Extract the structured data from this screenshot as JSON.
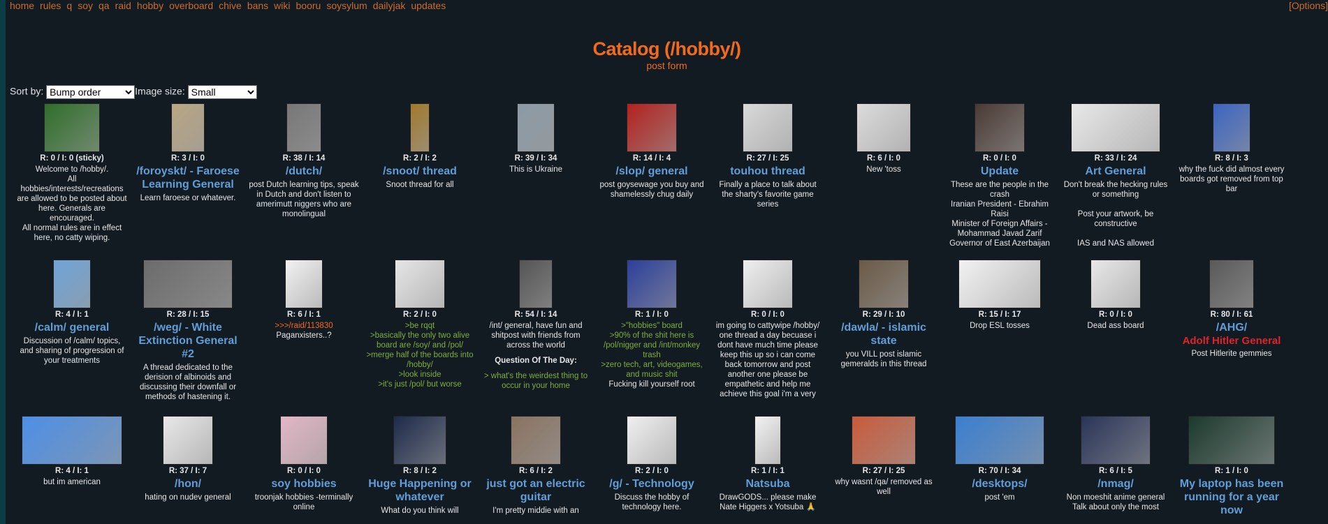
{
  "nav": {
    "links": [
      "home",
      "rules",
      "q",
      "soy",
      "qa",
      "raid",
      "hobby",
      "overboard",
      "chive",
      "bans",
      "wiki",
      "booru",
      "soysylum",
      "dailyjak",
      "updates"
    ],
    "options": "[Options]"
  },
  "header": {
    "title": "Catalog (/hobby/)",
    "post_form": "post form"
  },
  "controls": {
    "sort_label": "Sort by:",
    "sort_value": "Bump order",
    "image_label": "Image size:",
    "image_value": "Small"
  },
  "threads": [
    {
      "stats": "R: 0 / I: 0 (sticky)",
      "subject": "",
      "body": "Welcome to /hobby/.\nAll hobbies/interests/recreations are allowed to be posted about here. Generals are encouraged.\nAll normal rules are in effect here, no catty wiping.",
      "thumb": "#2f6e2a"
    },
    {
      "stats": "R: 3 / I: 0",
      "subject": "/foroyskt/ - Faroese Learning General",
      "body": "Learn faroese or whatever.",
      "thumb": "#b9a684"
    },
    {
      "stats": "R: 38 / I: 14",
      "subject": "/dutch/",
      "body": "post Dutch learning tips, speak in Dutch and don't listen to amerimutt niggers who are monolingual",
      "thumb": "#777777"
    },
    {
      "stats": "R: 2 / I: 2",
      "subject": "/snoot/ thread",
      "body": "Snoot thread for all",
      "thumb": "#a27a2c"
    },
    {
      "stats": "R: 39 / I: 34",
      "subject": "",
      "body": "This is Ukraine",
      "thumb": "#8c9aa6"
    },
    {
      "stats": "R: 14 / I: 4",
      "subject": "/slop/ general",
      "body": "post goysewage you buy and shamelessly chug daily",
      "thumb": "#b2221f"
    },
    {
      "stats": "R: 27 / I: 25",
      "subject": "touhou thread",
      "body": "Finally a place to talk about the sharty's favorite game series",
      "thumb": "#d9d9d9"
    },
    {
      "stats": "R: 6 / I: 0",
      "subject": "",
      "body": "New 'toss",
      "thumb": "#dcdcdc"
    },
    {
      "stats": "R: 0 / I: 0",
      "subject": "Update",
      "body": "These are the people in the crash\nIranian President - Ebrahim Raisi\nMinister of Foreign Affairs - Mohammad Javad Zarif\nGovernor of East Azerbaijan",
      "thumb": "#4a3a34"
    },
    {
      "stats": "R: 33 / I: 24",
      "subject": "Art General",
      "body": "Don't break the hecking rules or something\n\nPost your artwork, be constructive\n\nIAS and NAS allowed",
      "thumb": "#e8e8e8"
    },
    {
      "stats": "R: 8 / I: 3",
      "subject": "",
      "body": "why the fuck did almost every boards got removed from top bar",
      "thumb": "#3b64c2"
    },
    {
      "stats": "R: 4 / I: 1",
      "subject": "/calm/ general",
      "body": "Discussion of /calm/ topics, and sharing of progression of your treatments",
      "thumb": "#6fa4d9"
    },
    {
      "stats": "R: 28 / I: 15",
      "subject": "/weg/ - White Extinction General #2",
      "body": "A thread dedicated to the derision of albinoids and discussing their downfall or methods of hastening it.",
      "thumb": "#6c6c6c"
    },
    {
      "stats": "R: 6 / I: 1",
      "subject": "",
      "link": ">>>/raid/113830",
      "body": "Paganxisters..?",
      "thumb": "#f2f2f2"
    },
    {
      "stats": "R: 2 / I: 0",
      "subject": "",
      "greentext": ">be rqqt\n>basically the only two alive board are /soy/ and /pol/\n>merge half of the boards into /hobby/\n>look inside\n>it's just /pol/ but worse",
      "body": "",
      "thumb": "#e6e6e6"
    },
    {
      "stats": "R: 54 / I: 14",
      "subject": "",
      "body": "/int/ general, have fun and shitpost with friends from across the world",
      "qotd": "Question Of The Day:",
      "greentext": "> what's the weirdest thing to occur in your home",
      "thumb": "#555555"
    },
    {
      "stats": "R: 1 / I: 0",
      "subject": "",
      "greentext": ">\"hobbies\" board\n>90% of the shit here is /pol/nigger and /int/monkey trash\n>zero tech, art, videogames, and music shit",
      "body": "Fucking kill yourself root",
      "thumb": "#2c3f9b"
    },
    {
      "stats": "R: 0 / I: 0",
      "subject": "",
      "body": "im going to cattywipe /hobby/ one thread a day becuase i dont have much time please keep this up so i can come back tomorrow and post another one please be empathetic and help me achieve this goal i'm a very",
      "thumb": "#efefef"
    },
    {
      "stats": "R: 29 / I: 10",
      "subject": "/dawla/ - islamic state",
      "body": "you VILL post islamic gemeralds in this thread",
      "thumb": "#6b5a47"
    },
    {
      "stats": "R: 15 / I: 17",
      "subject": "",
      "body": "Drop ESL tosses",
      "thumb": "#f2f2f2"
    },
    {
      "stats": "R: 0 / I: 0",
      "subject": "",
      "body": "Dead ass board",
      "thumb": "#e8e8e8"
    },
    {
      "stats": "R: 80 / I: 61",
      "subject": "/AHG/",
      "red": "Adolf Hitler General",
      "body": "Post Hitlerite gemmies",
      "thumb": "#5a5a5a"
    },
    {
      "stats": "R: 4 / I: 1",
      "subject": "",
      "body": "but im american",
      "thumb": "#4d8fe6"
    },
    {
      "stats": "R: 37 / I: 7",
      "subject": "/hon/",
      "body": "hating on nudev general",
      "thumb": "#e8e8e8"
    },
    {
      "stats": "R: 0 / I: 0",
      "subject": "soy hobbies",
      "body": "troonjak hobbies -terminally online",
      "thumb": "#e2b7c6"
    },
    {
      "stats": "R: 8 / I: 2",
      "subject": "Huge Happening or whatever",
      "body": "What do you think will",
      "thumb": "#1d2a4a"
    },
    {
      "stats": "R: 6 / I: 2",
      "subject": "just got an electric guitar",
      "body": "I'm pretty middie with an",
      "thumb": "#8a7362"
    },
    {
      "stats": "R: 2 / I: 0",
      "subject": "/g/ - Technology",
      "body": "Discuss the hobby of technology here.",
      "thumb": "#f0f0f0"
    },
    {
      "stats": "R: 1 / I: 1",
      "subject": "Natsuba",
      "body": "DrawGODS... please make Nate Higgers x Yotsuba 🙏",
      "thumb": "#f2f2f2"
    },
    {
      "stats": "R: 27 / I: 25",
      "subject": "",
      "body": "why wasnt /qa/ removed as well",
      "thumb": "#c95b3c"
    },
    {
      "stats": "R: 70 / I: 34",
      "subject": "/desktops/",
      "body": "post 'em",
      "thumb": "#3a7fd1"
    },
    {
      "stats": "R: 6 / I: 5",
      "subject": "/nmag/",
      "body": "Non moeshit anime general\nTalk about only the most",
      "thumb": "#2a3558"
    },
    {
      "stats": "R: 1 / I: 0",
      "subject": "My laptop has been running for a year now",
      "body": "",
      "thumb": "#1c3a2e"
    }
  ]
}
